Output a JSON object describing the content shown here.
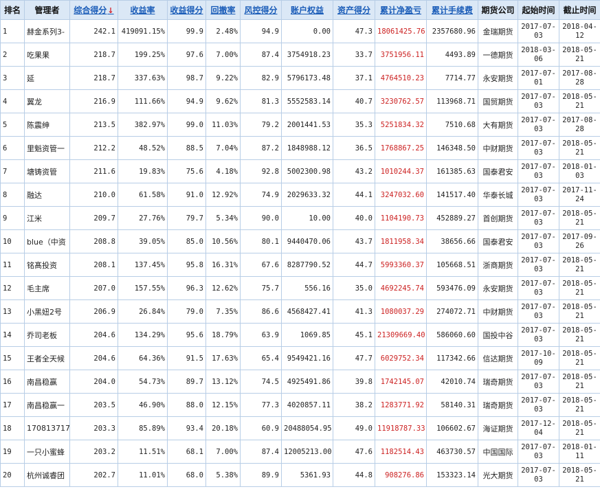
{
  "headers": {
    "rank": "排名",
    "manager": "管理者",
    "composite": "综合得分",
    "return_rate": "收益率",
    "return_score": "收益得分",
    "drawdown": "回撤率",
    "risk_score": "风控得分",
    "equity": "账户权益",
    "asset_score": "资产得分",
    "net_profit": "累计净盈亏",
    "fees": "累计手续费",
    "broker": "期货公司",
    "start": "起始时间",
    "end": "截止时间"
  },
  "sort_indicator": "↓",
  "colors": {
    "header_bg": "#dbe8f6",
    "border": "#b7cde6",
    "link": "#1a5cb8",
    "profit": "#cc2222"
  },
  "rows": [
    {
      "rank": "1",
      "manager": "赫金系列3-",
      "composite": "242.1",
      "return_rate": "419091.15%",
      "return_score": "99.9",
      "drawdown": "2.48%",
      "risk_score": "94.9",
      "equity": "0.00",
      "asset_score": "47.3",
      "net_profit": "18061425.76",
      "fees": "2357680.96",
      "broker": "金瑞期货",
      "start_a": "2017-07-",
      "start_b": "03",
      "end_a": "2018-04-",
      "end_b": "12"
    },
    {
      "rank": "2",
      "manager": "吃果果",
      "composite": "218.7",
      "return_rate": "199.25%",
      "return_score": "97.6",
      "drawdown": "7.00%",
      "risk_score": "87.4",
      "equity": "3754918.23",
      "asset_score": "33.7",
      "net_profit": "3751956.11",
      "fees": "4493.89",
      "broker": "一德期货",
      "start_a": "2018-03-",
      "start_b": "06",
      "end_a": "2018-05-",
      "end_b": "21"
    },
    {
      "rank": "3",
      "manager": "延",
      "composite": "218.7",
      "return_rate": "337.63%",
      "return_score": "98.7",
      "drawdown": "9.22%",
      "risk_score": "82.9",
      "equity": "5796173.48",
      "asset_score": "37.1",
      "net_profit": "4764510.23",
      "fees": "7714.77",
      "broker": "永安期货",
      "start_a": "2017-07-",
      "start_b": "01",
      "end_a": "2017-08-",
      "end_b": "28"
    },
    {
      "rank": "4",
      "manager": "翼龙",
      "composite": "216.9",
      "return_rate": "111.66%",
      "return_score": "94.9",
      "drawdown": "9.62%",
      "risk_score": "81.3",
      "equity": "5552583.14",
      "asset_score": "40.7",
      "net_profit": "3230762.57",
      "fees": "113968.71",
      "broker": "国贸期货",
      "start_a": "2017-07-",
      "start_b": "03",
      "end_a": "2018-05-",
      "end_b": "21"
    },
    {
      "rank": "5",
      "manager": "陈震绅",
      "composite": "213.5",
      "return_rate": "382.97%",
      "return_score": "99.0",
      "drawdown": "11.03%",
      "risk_score": "79.2",
      "equity": "2001441.53",
      "asset_score": "35.3",
      "net_profit": "5251834.32",
      "fees": "7510.68",
      "broker": "大有期货",
      "start_a": "2017-07-",
      "start_b": "03",
      "end_a": "2017-08-",
      "end_b": "28"
    },
    {
      "rank": "6",
      "manager": "里魁资管一",
      "composite": "212.2",
      "return_rate": "48.52%",
      "return_score": "88.5",
      "drawdown": "7.04%",
      "risk_score": "87.2",
      "equity": "1848988.12",
      "asset_score": "36.5",
      "net_profit": "1768867.25",
      "fees": "146348.50",
      "broker": "中财期货",
      "start_a": "2017-07-",
      "start_b": "03",
      "end_a": "2018-05-",
      "end_b": "21"
    },
    {
      "rank": "7",
      "manager": "塘铸资管",
      "composite": "211.6",
      "return_rate": "19.83%",
      "return_score": "75.6",
      "drawdown": "4.18%",
      "risk_score": "92.8",
      "equity": "5002300.98",
      "asset_score": "43.2",
      "net_profit": "1010244.37",
      "fees": "161385.63",
      "broker": "国泰君安",
      "start_a": "2017-07-",
      "start_b": "03",
      "end_a": "2018-01-",
      "end_b": "03"
    },
    {
      "rank": "8",
      "manager": "融达",
      "composite": "210.0",
      "return_rate": "61.58%",
      "return_score": "91.0",
      "drawdown": "12.92%",
      "risk_score": "74.9",
      "equity": "2029633.32",
      "asset_score": "44.1",
      "net_profit": "3247032.60",
      "fees": "141517.40",
      "broker": "华泰长城",
      "start_a": "2017-07-",
      "start_b": "03",
      "end_a": "2017-11-",
      "end_b": "24"
    },
    {
      "rank": "9",
      "manager": "江米",
      "composite": "209.7",
      "return_rate": "27.76%",
      "return_score": "79.7",
      "drawdown": "5.34%",
      "risk_score": "90.0",
      "equity": "10.00",
      "asset_score": "40.0",
      "net_profit": "1104190.73",
      "fees": "452889.27",
      "broker": "首创期货",
      "start_a": "2017-07-",
      "start_b": "03",
      "end_a": "2018-05-",
      "end_b": "21"
    },
    {
      "rank": "10",
      "manager": "blue（中资",
      "composite": "208.8",
      "return_rate": "39.05%",
      "return_score": "85.0",
      "drawdown": "10.56%",
      "risk_score": "80.1",
      "equity": "9440470.06",
      "asset_score": "43.7",
      "net_profit": "1811958.34",
      "fees": "38656.66",
      "broker": "国泰君安",
      "start_a": "2017-07-",
      "start_b": "03",
      "end_a": "2017-09-",
      "end_b": "26"
    },
    {
      "rank": "11",
      "manager": "铭髙投资",
      "composite": "208.1",
      "return_rate": "137.45%",
      "return_score": "95.8",
      "drawdown": "16.31%",
      "risk_score": "67.6",
      "equity": "8287790.52",
      "asset_score": "44.7",
      "net_profit": "5993360.37",
      "fees": "105668.51",
      "broker": "浙商期货",
      "start_a": "2017-07-",
      "start_b": "03",
      "end_a": "2018-05-",
      "end_b": "21"
    },
    {
      "rank": "12",
      "manager": "毛主席",
      "composite": "207.0",
      "return_rate": "157.55%",
      "return_score": "96.3",
      "drawdown": "12.62%",
      "risk_score": "75.7",
      "equity": "556.16",
      "asset_score": "35.0",
      "net_profit": "4692245.74",
      "fees": "593476.09",
      "broker": "永安期货",
      "start_a": "2017-07-",
      "start_b": "03",
      "end_a": "2018-05-",
      "end_b": "21"
    },
    {
      "rank": "13",
      "manager": "小黑妞2号",
      "composite": "206.9",
      "return_rate": "26.84%",
      "return_score": "79.0",
      "drawdown": "7.35%",
      "risk_score": "86.6",
      "equity": "4568427.41",
      "asset_score": "41.3",
      "net_profit": "1080037.29",
      "fees": "274072.71",
      "broker": "中财期货",
      "start_a": "2017-07-",
      "start_b": "03",
      "end_a": "2018-05-",
      "end_b": "21"
    },
    {
      "rank": "14",
      "manager": "乔司老板",
      "composite": "204.6",
      "return_rate": "134.29%",
      "return_score": "95.6",
      "drawdown": "18.79%",
      "risk_score": "63.9",
      "equity": "1069.85",
      "asset_score": "45.1",
      "net_profit": "21309669.40",
      "fees": "586060.60",
      "broker": "国投中谷",
      "start_a": "2017-07-",
      "start_b": "03",
      "end_a": "2018-05-",
      "end_b": "21"
    },
    {
      "rank": "15",
      "manager": "王者全天候",
      "composite": "204.6",
      "return_rate": "64.36%",
      "return_score": "91.5",
      "drawdown": "17.63%",
      "risk_score": "65.4",
      "equity": "9549421.16",
      "asset_score": "47.7",
      "net_profit": "6029752.34",
      "fees": "117342.66",
      "broker": "信达期货",
      "start_a": "2017-10-",
      "start_b": "09",
      "end_a": "2018-05-",
      "end_b": "21"
    },
    {
      "rank": "16",
      "manager": "南昌稳赢",
      "composite": "204.0",
      "return_rate": "54.73%",
      "return_score": "89.7",
      "drawdown": "13.12%",
      "risk_score": "74.5",
      "equity": "4925491.86",
      "asset_score": "39.8",
      "net_profit": "1742145.07",
      "fees": "42010.74",
      "broker": "瑞奇期货",
      "start_a": "2017-07-",
      "start_b": "03",
      "end_a": "2018-05-",
      "end_b": "21"
    },
    {
      "rank": "17",
      "manager": "南昌稳赢一",
      "composite": "203.5",
      "return_rate": "46.90%",
      "return_score": "88.0",
      "drawdown": "12.15%",
      "risk_score": "77.3",
      "equity": "4020857.11",
      "asset_score": "38.2",
      "net_profit": "1283771.92",
      "fees": "58140.31",
      "broker": "瑞奇期货",
      "start_a": "2017-07-",
      "start_b": "03",
      "end_a": "2018-05-",
      "end_b": "21"
    },
    {
      "rank": "18",
      "manager": "170813717",
      "composite": "203.3",
      "return_rate": "85.89%",
      "return_score": "93.4",
      "drawdown": "20.18%",
      "risk_score": "60.9",
      "equity": "20488054.95",
      "asset_score": "49.0",
      "net_profit": "11918787.33",
      "fees": "106602.67",
      "broker": "海证期货",
      "start_a": "2017-12-",
      "start_b": "04",
      "end_a": "2018-05-",
      "end_b": "21"
    },
    {
      "rank": "19",
      "manager": "一只小蜜蜂",
      "composite": "203.2",
      "return_rate": "11.51%",
      "return_score": "68.1",
      "drawdown": "7.00%",
      "risk_score": "87.4",
      "equity": "12005213.00",
      "asset_score": "47.6",
      "net_profit": "1182514.43",
      "fees": "463730.57",
      "broker": "中国国际",
      "start_a": "2017-07-",
      "start_b": "03",
      "end_a": "2018-01-",
      "end_b": "11"
    },
    {
      "rank": "20",
      "manager": "杭州诚睿团",
      "composite": "202.7",
      "return_rate": "11.01%",
      "return_score": "68.0",
      "drawdown": "5.38%",
      "risk_score": "89.9",
      "equity": "5361.93",
      "asset_score": "44.8",
      "net_profit": "908276.86",
      "fees": "153323.14",
      "broker": "光大期货",
      "start_a": "2017-07-",
      "start_b": "03",
      "end_a": "2018-05-",
      "end_b": "21"
    }
  ]
}
